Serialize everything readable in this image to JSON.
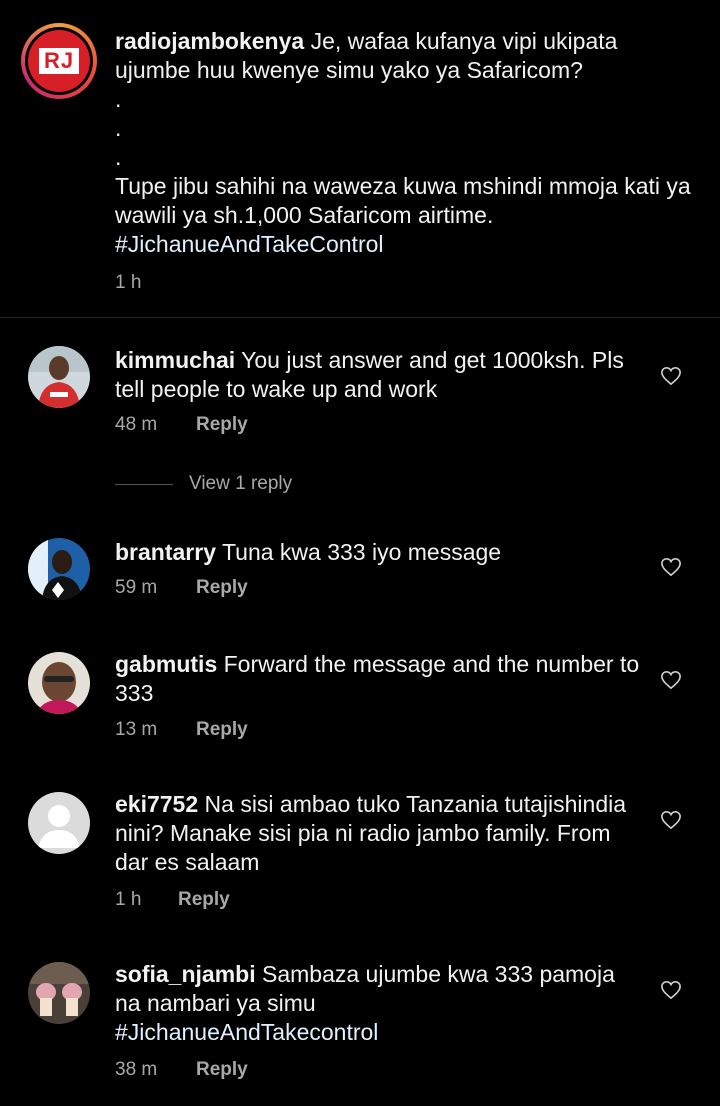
{
  "post": {
    "username": "radiojambokenya",
    "avatar_text": "RJ",
    "line1": "Je, wafaa kufanya vipi ukipata ujumbe huu kwenye simu yako ya Safaricom?",
    "dot1": ".",
    "dot2": ".",
    "dot3": ".",
    "line2": "Tupe jibu sahihi na waweza kuwa mshindi mmoja kati ya wawili ya sh.1,000 Safaricom airtime.",
    "hashtag": "#JichanueAndTakeControl",
    "time": "1 h"
  },
  "comments": [
    {
      "username": "kimmuchai",
      "text": "You just answer and get 1000ksh. Pls tell people to wake up and work",
      "time": "48 m",
      "reply": "Reply"
    },
    {
      "username": "brantarry",
      "text": "Tuna kwa 333 iyo message",
      "time": "59 m",
      "reply": "Reply"
    },
    {
      "username": "gabmutis",
      "text": "Forward the message and the number to 333",
      "time": "13 m",
      "reply": "Reply"
    },
    {
      "username": "eki7752",
      "text": "Na sisi ambao tuko Tanzania tutajishindia nini? Manake sisi pia ni radio jambo family.  From dar es salaam",
      "time": "1 h",
      "reply": "Reply"
    },
    {
      "username": "sofia_njambi",
      "text": "Sambaza ujumbe kwa 333 pamoja na nambari ya simu",
      "hashtag": "#JichanueAndTakecontrol",
      "time": "38 m",
      "reply": "Reply"
    }
  ],
  "view_replies": "View 1 reply",
  "colors": {
    "background": "#000000",
    "text": "#f2f2f2",
    "muted": "#a8a8a8",
    "hashtag": "#e0f1ff",
    "brand_red": "#d71f27"
  }
}
